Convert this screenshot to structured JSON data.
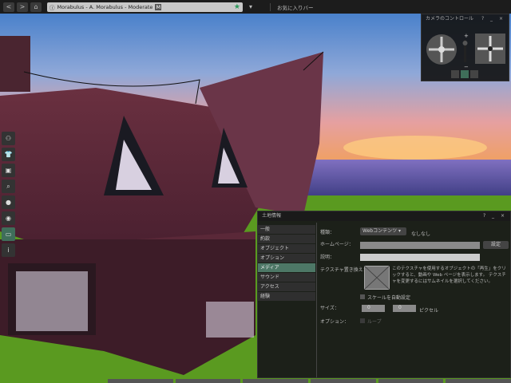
{
  "browser": {
    "url_title": "Morabulus - A. Morabulus - Moderate",
    "rating_badge": "M",
    "favorites_label": "お気に入りバー",
    "back": "<",
    "forward": ">"
  },
  "camera": {
    "title": "カメラのコントロール",
    "controls": "? _ ×",
    "zoom_plus": "+",
    "zoom_minus": "−"
  },
  "sidebar": {
    "icons": [
      "people-icon",
      "shirt-icon",
      "briefcase-icon",
      "search-icon",
      "lightbulb-icon",
      "radar-icon",
      "camera-icon",
      "info-icon"
    ]
  },
  "land": {
    "title": "土地情報",
    "controls": "? _ ×",
    "tabs": [
      "一般",
      "約款",
      "オブジェクト",
      "オプション",
      "メディア",
      "サウンド",
      "アクセス",
      "経験"
    ],
    "active_tab": "メディア",
    "type_label": "種類：",
    "type_value": "Webコンテンツ",
    "type_extra": "なしなし",
    "homepage_label": "ホームページ：",
    "set_button": "設定",
    "desc_label": "説明：",
    "texture_label": "テクスチャ置き換え：",
    "texture_help": "このテクスチャを使用するオブジェクトの「再生」をクリックすると、動画や Web ページを表示します。 テクスチャを変更するにはサムネイルを選択してください。",
    "auto_scale": "スケールを自動設定",
    "size_label": "サイズ：",
    "width": "0",
    "height": "0",
    "unit": "ピクセル",
    "options_label": "オプション：",
    "loop": "ループ"
  }
}
